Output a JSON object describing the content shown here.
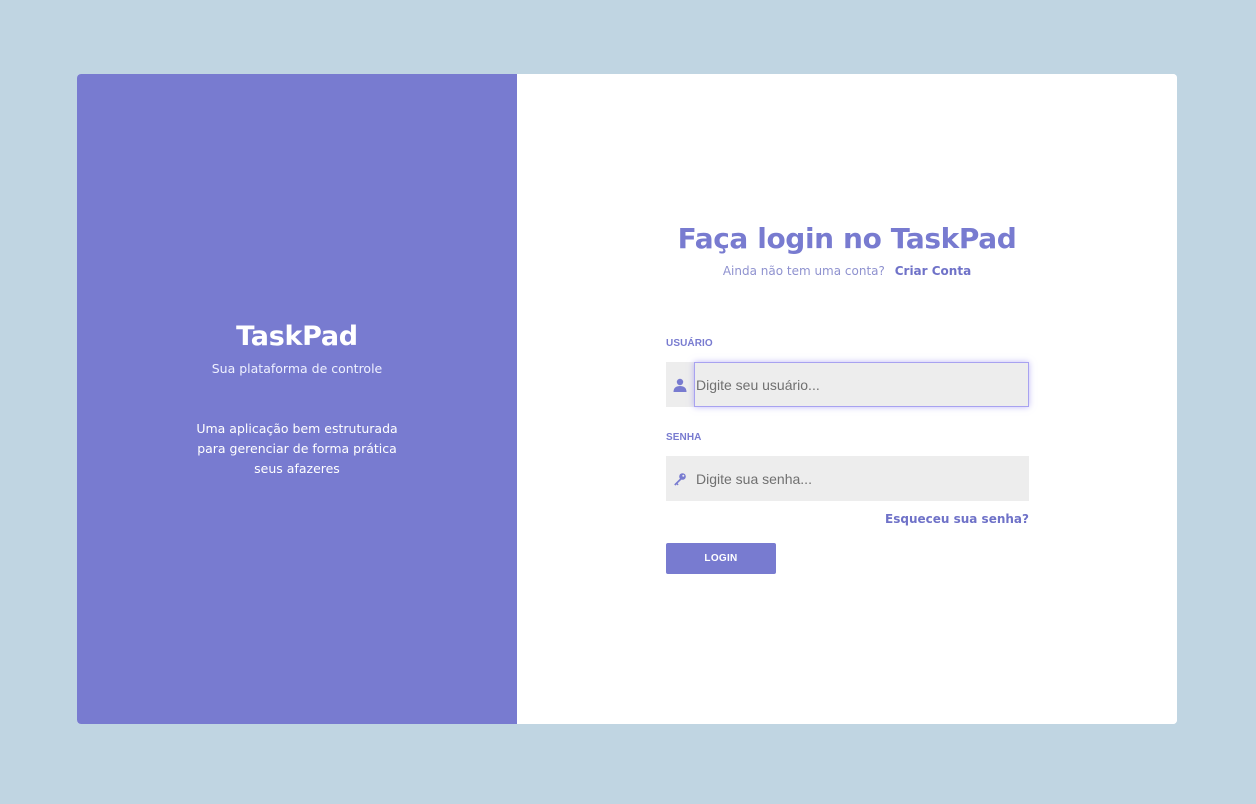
{
  "colors": {
    "page_background": "#c0d5e2",
    "brand_panel": "#787bd0",
    "accent": "#787bd0",
    "input_background": "#ededed"
  },
  "brand_panel": {
    "title": "TaskPad",
    "subtitle": "Sua plataforma de controle",
    "description": "Uma aplicação bem estruturada para gerenciar de forma prática seus afazeres"
  },
  "login_form": {
    "title": "Faça login no TaskPad",
    "signup_prompt": "Ainda não tem uma conta?",
    "signup_link": "Criar Conta",
    "username": {
      "label": "USUÁRIO",
      "placeholder": "Digite seu usuário...",
      "value": "",
      "icon": "user-icon"
    },
    "password": {
      "label": "SENHA",
      "placeholder": "Digite sua senha...",
      "value": "",
      "icon": "key-icon"
    },
    "forgot_password": "Esqueceu sua senha?",
    "submit_label": "LOGIN"
  }
}
